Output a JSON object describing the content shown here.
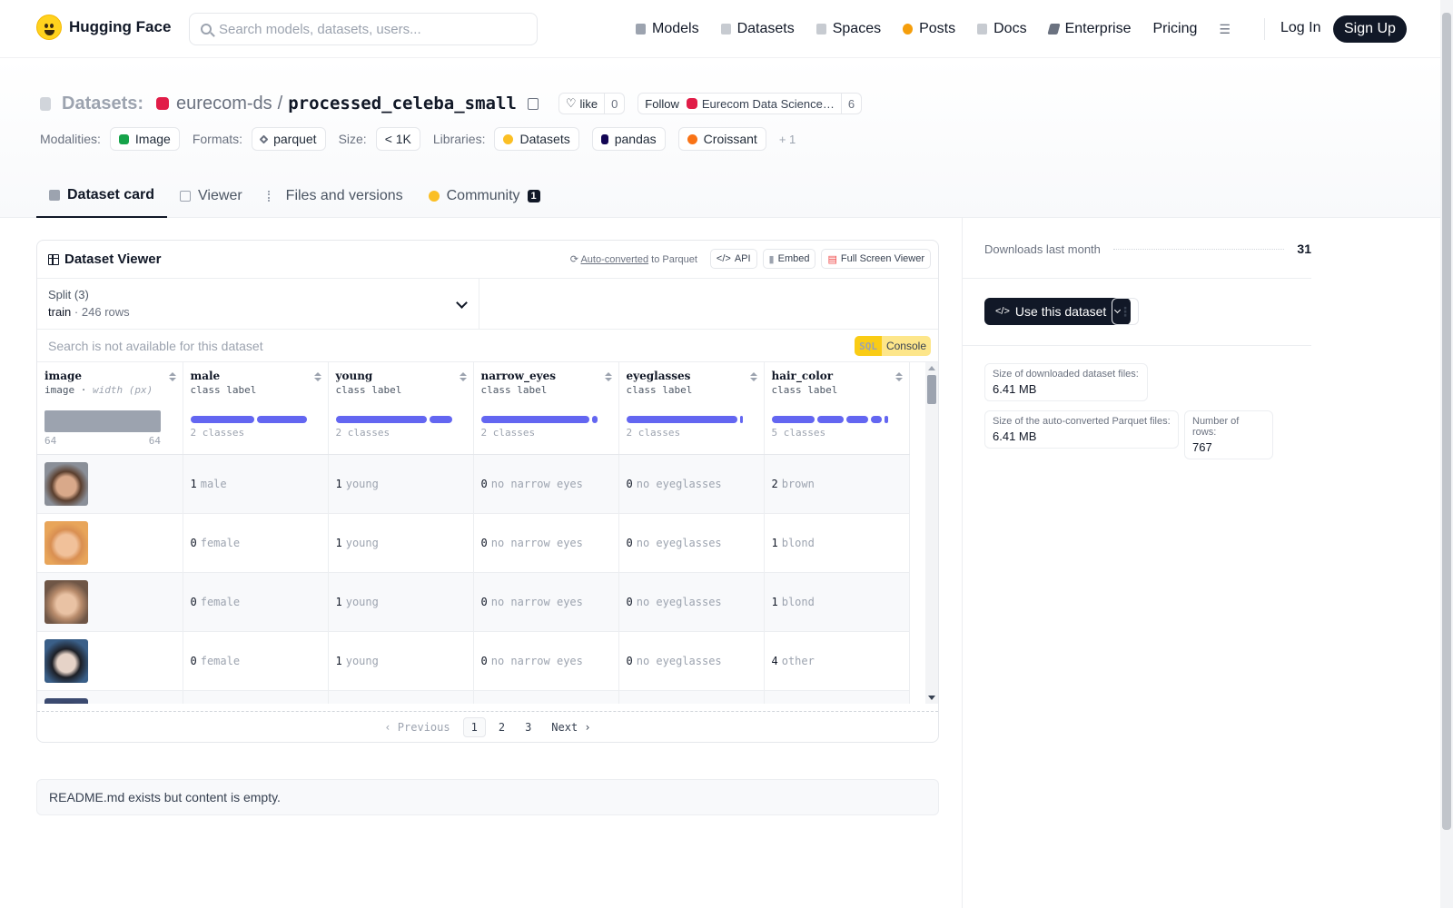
{
  "nav": {
    "brand": "Hugging Face",
    "search_placeholder": "Search models, datasets, users...",
    "links": [
      {
        "label": "Models",
        "icon": "cube-icon",
        "color": "#9ca3af"
      },
      {
        "label": "Datasets",
        "icon": "database-icon",
        "color": "#9ca3af"
      },
      {
        "label": "Spaces",
        "icon": "spaces-grid-icon",
        "color": "#9ca3af"
      },
      {
        "label": "Posts",
        "icon": "posts-icon",
        "color": "#f59e0b"
      },
      {
        "label": "Docs",
        "icon": "docs-icon",
        "color": "#9ca3af"
      },
      {
        "label": "Enterprise",
        "icon": "enterprise-icon",
        "color": "#6b7280"
      },
      {
        "label": "Pricing",
        "icon": "",
        "color": ""
      }
    ],
    "login": "Log In",
    "signup": "Sign Up"
  },
  "header": {
    "prefix": "Datasets:",
    "owner": "eurecom-ds",
    "separator": "/",
    "dataset_name": "processed_celeba_small",
    "like_label": "like",
    "like_count": "0",
    "follow_label": "Follow",
    "follow_org": "Eurecom Data Science…",
    "follow_count": "6",
    "modalities_label": "Modalities:",
    "modalities": [
      {
        "label": "Image",
        "color": "#16a34a"
      }
    ],
    "formats_label": "Formats:",
    "formats": [
      {
        "label": "parquet",
        "color": "#6b7280"
      }
    ],
    "size_label": "Size:",
    "size": "< 1K",
    "libraries_label": "Libraries:",
    "libraries": [
      {
        "label": "Datasets",
        "color": "#fbbf24"
      },
      {
        "label": "pandas",
        "color": "#130654"
      },
      {
        "label": "Croissant",
        "color": "#f97316"
      }
    ],
    "libraries_more": "+ 1"
  },
  "tabs": [
    {
      "label": "Dataset card",
      "active": true
    },
    {
      "label": "Viewer",
      "active": false
    },
    {
      "label": "Files and versions",
      "active": false
    },
    {
      "label": "Community",
      "active": false,
      "badge": "1"
    }
  ],
  "viewer": {
    "title": "Dataset Viewer",
    "auto_converted": "Auto-converted",
    "to_parquet": "to Parquet",
    "api": "API",
    "embed": "Embed",
    "full_screen": "Full Screen Viewer",
    "split_label": "Split (3)",
    "split_value": "train",
    "split_rows": "246 rows",
    "search_disabled": "Search is not available for this dataset",
    "sql": "SQL",
    "console": "Console",
    "columns": [
      {
        "name": "image",
        "type": "image",
        "subtype": "width (px)",
        "range_min": "64",
        "range_max": "64"
      },
      {
        "name": "male",
        "type": "class label",
        "classes": "2 classes"
      },
      {
        "name": "young",
        "type": "class label",
        "classes": "2 classes"
      },
      {
        "name": "narrow_eyes",
        "type": "class label",
        "classes": "2 classes"
      },
      {
        "name": "eyeglasses",
        "type": "class label",
        "classes": "2 classes"
      },
      {
        "name": "hair_color",
        "type": "class label",
        "classes": "5 classes"
      }
    ],
    "rows": [
      {
        "face_color": "#7a5a44",
        "male": [
          "1",
          "male"
        ],
        "young": [
          "1",
          "young"
        ],
        "narrow_eyes": [
          "0",
          "no narrow eyes"
        ],
        "eyeglasses": [
          "0",
          "no eyeglasses"
        ],
        "hair_color": [
          "2",
          "brown"
        ]
      },
      {
        "face_color": "#d98f52",
        "male": [
          "0",
          "female"
        ],
        "young": [
          "1",
          "young"
        ],
        "narrow_eyes": [
          "0",
          "no narrow eyes"
        ],
        "eyeglasses": [
          "0",
          "no eyeglasses"
        ],
        "hair_color": [
          "1",
          "blond"
        ]
      },
      {
        "face_color": "#b98c6c",
        "male": [
          "0",
          "female"
        ],
        "young": [
          "1",
          "young"
        ],
        "narrow_eyes": [
          "0",
          "no narrow eyes"
        ],
        "eyeglasses": [
          "0",
          "no eyeglasses"
        ],
        "hair_color": [
          "1",
          "blond"
        ]
      },
      {
        "face_color": "#3a3d4a",
        "male": [
          "0",
          "female"
        ],
        "young": [
          "1",
          "young"
        ],
        "narrow_eyes": [
          "0",
          "no narrow eyes"
        ],
        "eyeglasses": [
          "0",
          "no eyeglasses"
        ],
        "hair_color": [
          "4",
          "other"
        ]
      }
    ],
    "pager": {
      "previous": "Previous",
      "pages": [
        "1",
        "2",
        "3"
      ],
      "current": "1",
      "next": "Next"
    }
  },
  "readme_text": "README.md exists but content is empty.",
  "sidebar": {
    "downloads_label": "Downloads last month",
    "downloads_value": "31",
    "use_button": "Use this dataset",
    "stats": [
      {
        "label": "Size of downloaded dataset files:",
        "value": "6.41 MB"
      },
      {
        "label": "Size of the auto-converted Parquet files:",
        "value": "6.41 MB"
      },
      {
        "label": "Number of rows:",
        "value": "767"
      }
    ]
  }
}
